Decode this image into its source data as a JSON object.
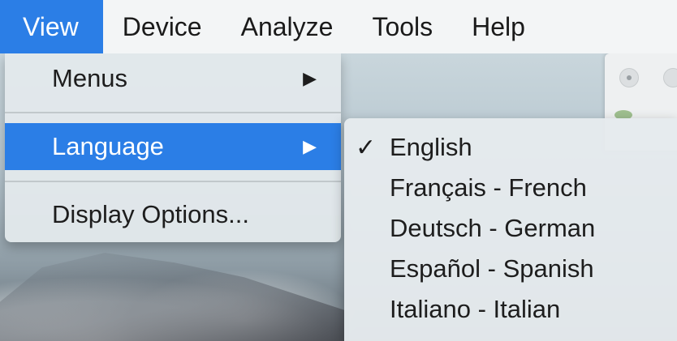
{
  "menubar": {
    "items": [
      {
        "label": "View"
      },
      {
        "label": "Device"
      },
      {
        "label": "Analyze"
      },
      {
        "label": "Tools"
      },
      {
        "label": "Help"
      }
    ]
  },
  "view_menu": {
    "items": [
      {
        "label": "Menus",
        "arrow": "▶"
      },
      {
        "label": "Language",
        "arrow": "▶"
      },
      {
        "label": "Display Options..."
      }
    ]
  },
  "language_submenu": {
    "check": "✓",
    "items": [
      {
        "label": "English",
        "checked": true
      },
      {
        "label": "Français - French"
      },
      {
        "label": "Deutsch - German"
      },
      {
        "label": "Español - Spanish"
      },
      {
        "label": "Italiano - Italian"
      }
    ]
  },
  "colors": {
    "highlight": "#2b7ee6",
    "menu_bg": "#e2e8eb",
    "text": "#1d1d1d"
  }
}
